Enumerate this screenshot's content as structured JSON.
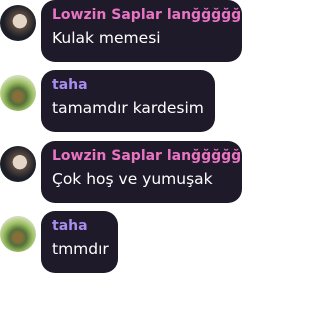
{
  "messages": [
    {
      "username": "Lowzin Saplar lanğğğğğ",
      "text": "Kulak memesi",
      "name_color": "#ea74c4",
      "avatar": "profile-photo-dark"
    },
    {
      "username": "taha",
      "text": "tamamdır kardesim",
      "name_color": "#a98cf0",
      "avatar": "profile-photo-green"
    },
    {
      "username": "Lowzin Saplar lanğğğğğ",
      "text": "Çok hoş ve yumuşak",
      "name_color": "#ea74c4",
      "avatar": "profile-photo-dark"
    },
    {
      "username": "taha",
      "text": "tmmdır",
      "name_color": "#a98cf0",
      "avatar": "profile-photo-green"
    }
  ]
}
